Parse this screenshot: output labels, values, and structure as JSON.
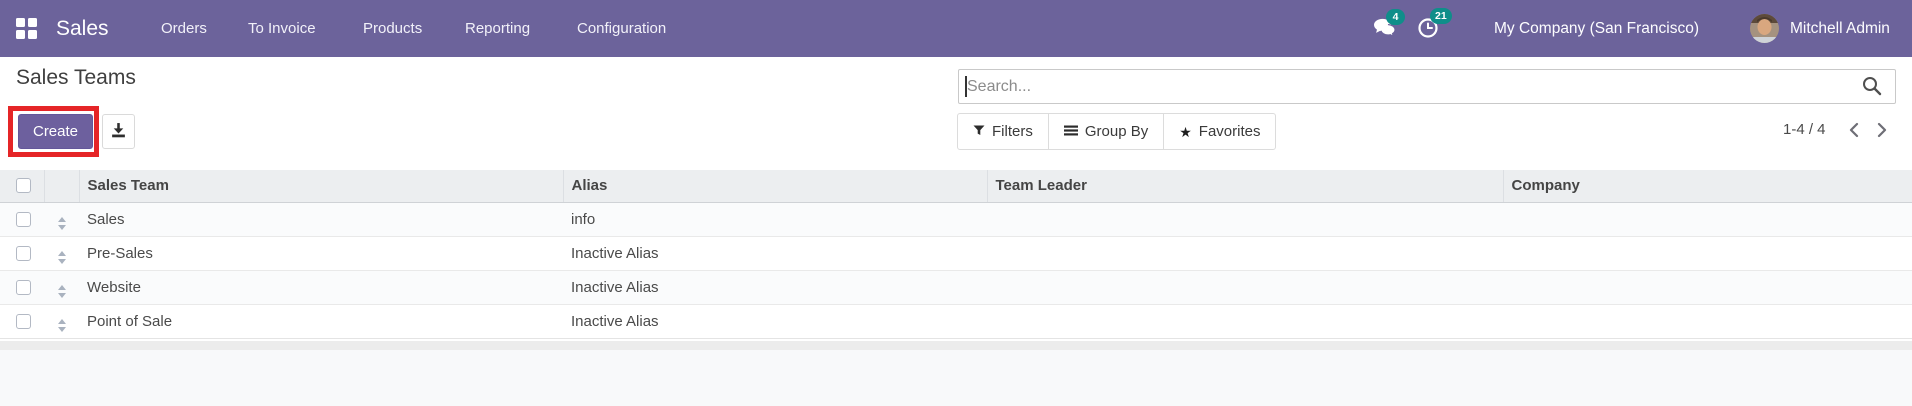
{
  "navbar": {
    "brand": "Sales",
    "menu": [
      "Orders",
      "To Invoice",
      "Products",
      "Reporting",
      "Configuration"
    ],
    "messages_badge": "4",
    "activities_badge": "21",
    "company": "My Company (San Francisco)",
    "user": "Mitchell Admin"
  },
  "page": {
    "title": "Sales Teams"
  },
  "actions": {
    "create": "Create"
  },
  "search": {
    "placeholder": "Search..."
  },
  "filters_bar": {
    "filters": "Filters",
    "group_by": "Group By",
    "favorites": "Favorites"
  },
  "pager": {
    "range": "1-4 / 4"
  },
  "table": {
    "headers": {
      "sales_team": "Sales Team",
      "alias": "Alias",
      "team_leader": "Team Leader",
      "company": "Company"
    },
    "rows": [
      {
        "sales_team": "Sales",
        "alias": "info",
        "team_leader": "",
        "company": ""
      },
      {
        "sales_team": "Pre-Sales",
        "alias": "Inactive Alias",
        "team_leader": "",
        "company": ""
      },
      {
        "sales_team": "Website",
        "alias": "Inactive Alias",
        "team_leader": "",
        "company": ""
      },
      {
        "sales_team": "Point of Sale",
        "alias": "Inactive Alias",
        "team_leader": "",
        "company": ""
      }
    ]
  },
  "icons": {
    "star": "★"
  },
  "colors": {
    "navbar": "#6c639b",
    "primary_button": "#6d609e",
    "badge": "#0f8e8a",
    "annotation_highlight": "#e52527"
  }
}
